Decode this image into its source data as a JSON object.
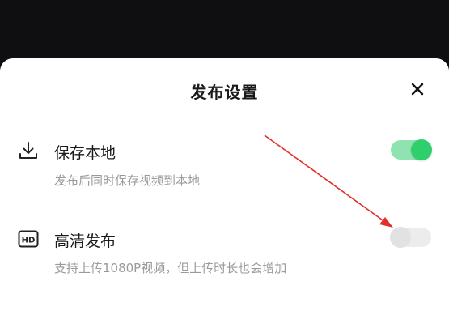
{
  "dialog": {
    "title": "发布设置",
    "close_icon": "close-icon"
  },
  "options": [
    {
      "label": "保存本地",
      "description": "发布后同时保存视频到本地",
      "icon": "download-icon",
      "enabled": true
    },
    {
      "label": "高清发布",
      "description": "支持上传1080P视频，但上传时长也会增加",
      "icon": "hd-icon",
      "icon_text": "HD",
      "enabled": false
    }
  ],
  "colors": {
    "toggle_on": "#2fcf6b",
    "toggle_track_on": "#8fe3b0",
    "toggle_off": "#e2e2e2",
    "annotation_arrow": "#e0302a"
  }
}
